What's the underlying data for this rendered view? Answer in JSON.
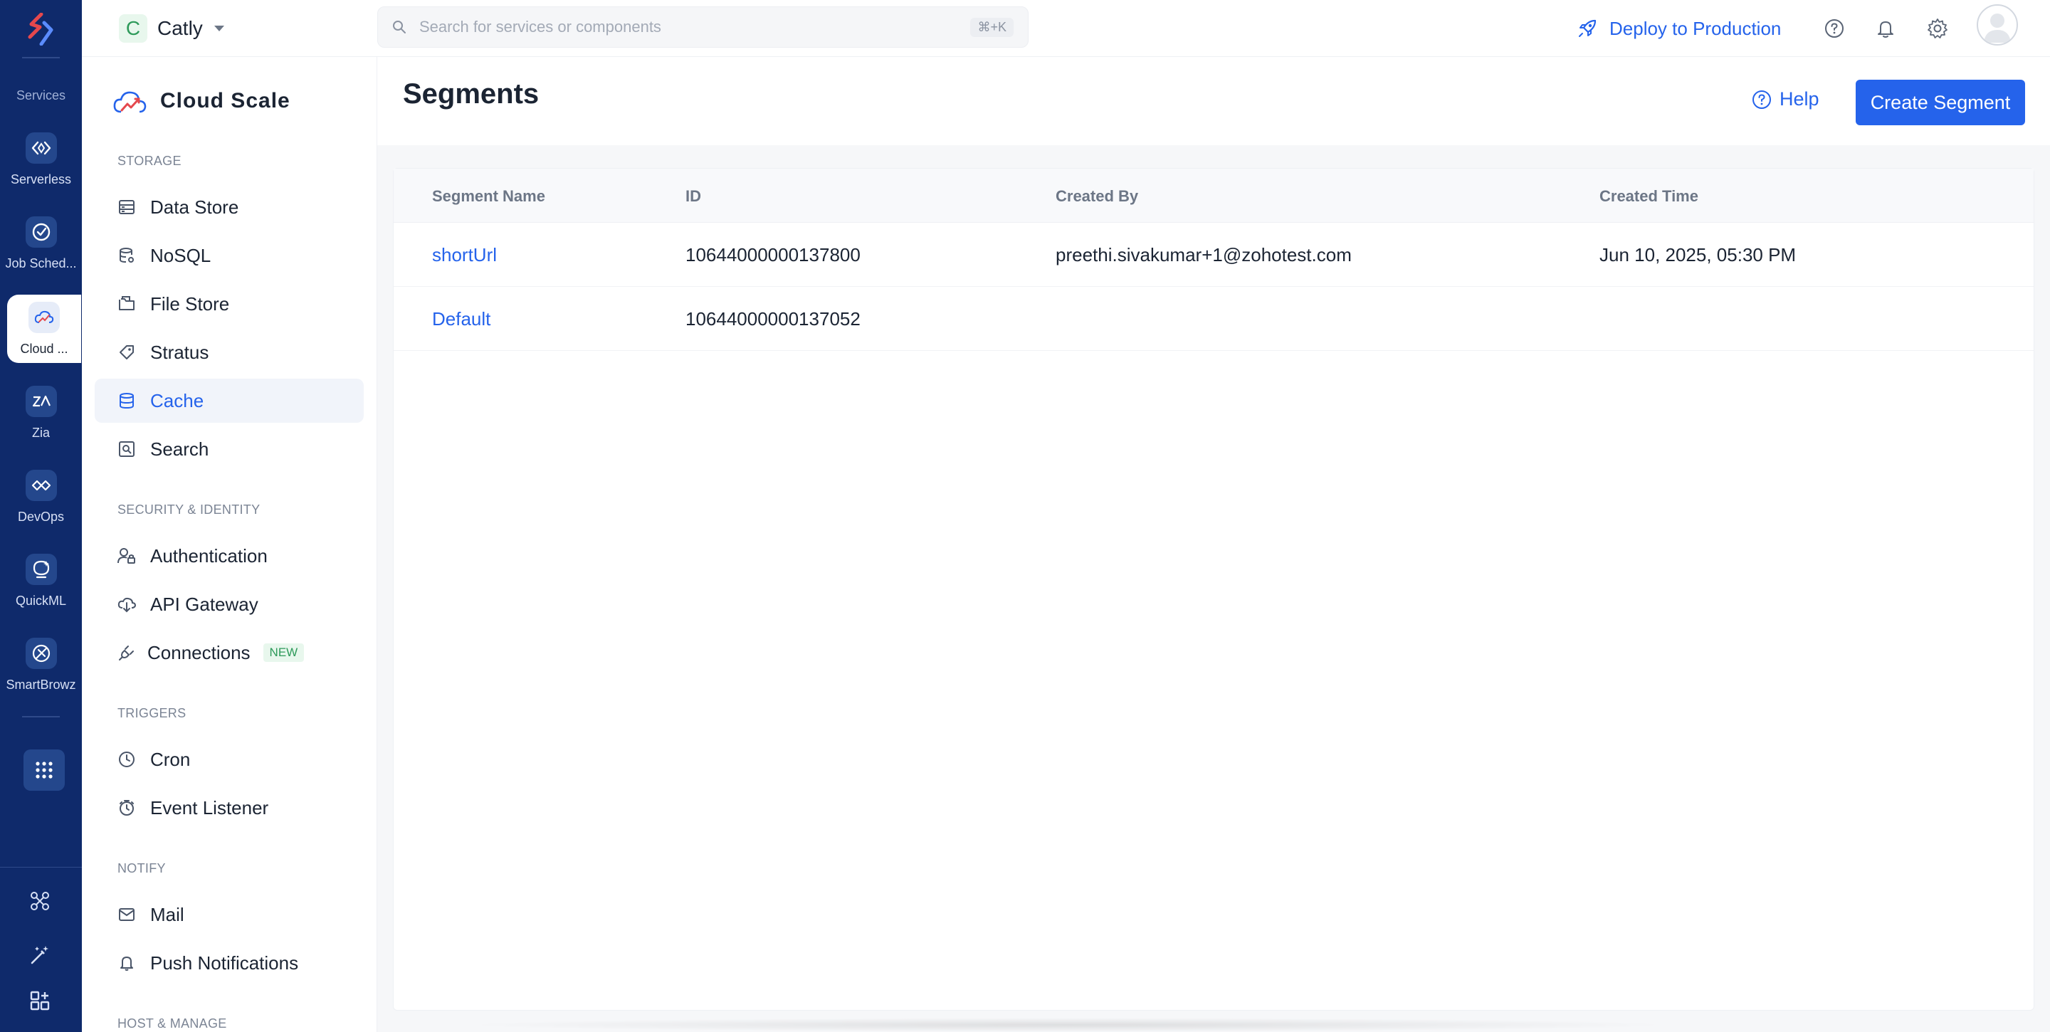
{
  "rail": {
    "section_label": "Services",
    "items": [
      {
        "label": "Serverless",
        "icon": "code-brackets-icon"
      },
      {
        "label": "Job Sched...",
        "icon": "check-circle-icon"
      },
      {
        "label": "Cloud ...",
        "icon": "cloud-scale-icon",
        "active": true
      },
      {
        "label": "Zia",
        "icon": "zia-icon"
      },
      {
        "label": "DevOps",
        "icon": "devops-icon"
      },
      {
        "label": "QuickML",
        "icon": "quickml-icon"
      },
      {
        "label": "SmartBrowz",
        "icon": "smartbrowz-icon"
      }
    ],
    "apps_icon": "grid-dots-icon",
    "bottom_icons": [
      "integrations-icon",
      "magic-wand-icon",
      "add-widget-icon"
    ]
  },
  "topbar": {
    "project_initial": "C",
    "project_name": "Catly",
    "search_placeholder": "Search for services or components",
    "search_shortcut": "⌘+K",
    "deploy_label": "Deploy to Production"
  },
  "sidebar": {
    "brand": "Cloud Scale",
    "sections": {
      "storage": "STORAGE",
      "security": "SECURITY & IDENTITY",
      "triggers": "TRIGGERS",
      "notify": "NOTIFY",
      "host": "HOST & MANAGE"
    },
    "items": {
      "data_store": "Data Store",
      "nosql": "NoSQL",
      "file_store": "File Store",
      "stratus": "Stratus",
      "cache": "Cache",
      "search": "Search",
      "authentication": "Authentication",
      "api_gateway": "API Gateway",
      "connections": "Connections",
      "connections_badge": "NEW",
      "cron": "Cron",
      "event_listener": "Event Listener",
      "mail": "Mail",
      "push_notifications": "Push Notifications"
    }
  },
  "main": {
    "title": "Segments",
    "help_label": "Help",
    "create_label": "Create Segment",
    "columns": [
      "Segment Name",
      "ID",
      "Created By",
      "Created Time"
    ],
    "rows": [
      {
        "name": "shortUrl",
        "id": "10644000000137800",
        "created_by": "preethi.sivakumar+1@zohotest.com",
        "created_time": "Jun 10, 2025, 05:30 PM"
      },
      {
        "name": "Default",
        "id": "10644000000137052",
        "created_by": "",
        "created_time": ""
      }
    ]
  },
  "colors": {
    "rail_bg": "#0f2a6b",
    "accent": "#2563eb",
    "new_badge": "#2e9a5a"
  }
}
